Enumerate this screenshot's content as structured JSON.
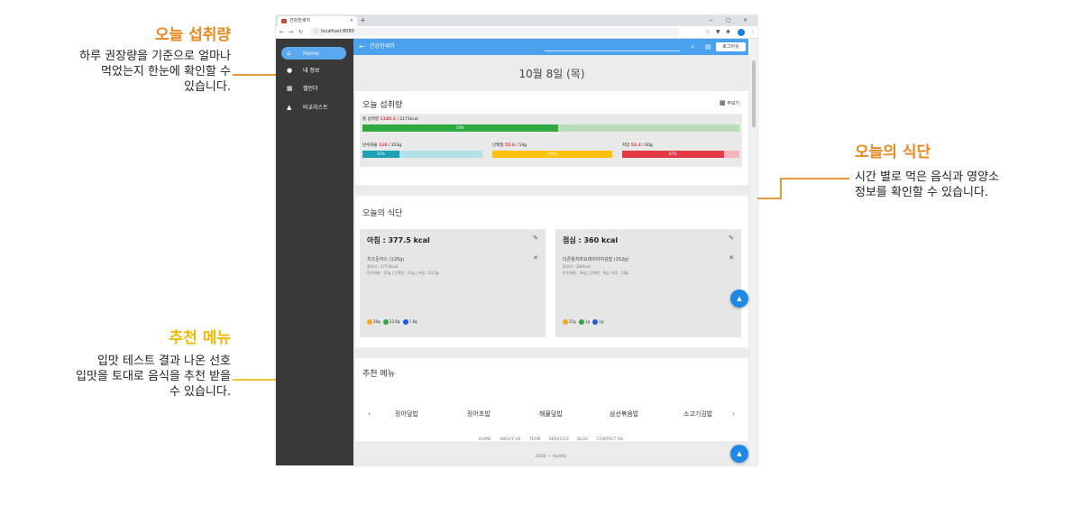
{
  "annotations": {
    "intake": {
      "title": "오늘 섭취량",
      "lines": [
        "하루 권장량을 기준으로 얼마나",
        "먹었는지 한눈에 확인할 수",
        "있습니다."
      ],
      "color": "#e8891f"
    },
    "diet": {
      "title": "오늘의 식단",
      "lines": [
        "시간 별로 먹은 음식과 영양소",
        "정보를 확인할 수 있습니다."
      ],
      "color": "#e8891f"
    },
    "recommend": {
      "title": "추천 메뉴",
      "lines": [
        "입맛 테스트 결과 나온 선호",
        "입맛을 토대로 음식을 추천 받을",
        "수 있습니다."
      ],
      "color": "#f2b800"
    }
  },
  "browser": {
    "tab_title": "건강한세끼",
    "tab_close": "×",
    "new_tab": "+",
    "win_min": "−",
    "win_max": "▢",
    "win_close": "×",
    "url": "localhost:8080"
  },
  "sidebar": {
    "items": [
      {
        "label": "Home",
        "icon": "home-icon",
        "glyph": "⌂"
      },
      {
        "label": "내 정보",
        "icon": "person-icon",
        "glyph": "●"
      },
      {
        "label": "캘린더",
        "icon": "calendar-icon",
        "glyph": "▦"
      },
      {
        "label": "비교리스트",
        "icon": "thumb-up-icon",
        "glyph": "▲"
      }
    ]
  },
  "appbar": {
    "back_glyph": "←",
    "title": "건강한세끼",
    "logout": "로그아웃"
  },
  "main": {
    "date": "10월 8일 (목)",
    "intake": {
      "title": "오늘 섭취량",
      "calendar_label": "주보기",
      "total": {
        "label": "총 섭취량",
        "value": "1130.3",
        "goal": " / 2171kcal",
        "pct_text": "50%",
        "pct": 0.52
      },
      "nutrients": [
        {
          "label": "탄수화물",
          "value": "110",
          "goal": " / 353g",
          "pct_text": "31%",
          "pct": 0.31,
          "fill": "#1fa1b4",
          "track": "#b2e0e8"
        },
        {
          "label": "단백질",
          "value": "55.8",
          "goal": " / 54g",
          "pct_text": "100%",
          "pct": 1.0,
          "fill": "#ffc107",
          "track": "#ffe082"
        },
        {
          "label": "지방",
          "value": "52.3",
          "goal": " / 60g",
          "pct_text": "87%",
          "pct": 0.87,
          "fill": "#e53945",
          "track": "#f4b6bc"
        }
      ],
      "total_fill": "#2eaa40",
      "total_track": "#b8ddb8"
    },
    "diet": {
      "title": "오늘의 식단",
      "meals": [
        {
          "title": "아침 : 377.5 kcal",
          "food": "치즈돈까스 (125g)",
          "sub1": "칼로리 : 377.5kcal",
          "sub2": "탄수화물 : 21g | 단백질 : 21g | 지방 : 23.5g",
          "chips": "28g",
          "chip2": "22.8g",
          "chip3": "7.8g"
        },
        {
          "title": "점심 : 360 kcal",
          "food": "더존참치마요데리야끼김밥 (152g)",
          "sub1": "칼로리 : 360kcal",
          "sub2": "탄수화물 : 3kg | 단백질 : 9g | 지방 : 20g",
          "chips": "25g",
          "chip2": "1g",
          "chip3": "1g"
        }
      ]
    },
    "recommend": {
      "title": "추천 메뉴",
      "prev": "‹",
      "next": "›",
      "items": [
        "장어덮밥",
        "장어초밥",
        "해물덮밥",
        "삼선볶음밥",
        "소고기김밥"
      ]
    }
  },
  "footer": {
    "links": [
      "HOME",
      "ABOUT US",
      "TEAM",
      "SERVICES",
      "BLOG",
      "CONTACT US"
    ],
    "copy": "2020 — Vuetify"
  }
}
